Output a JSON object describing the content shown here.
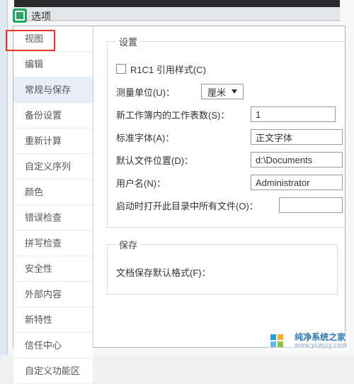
{
  "header": {
    "title": "选项"
  },
  "sidebar": {
    "items": [
      "视图",
      "编辑",
      "常规与保存",
      "备份设置",
      "重新计算",
      "自定义序列",
      "颜色",
      "错误检查",
      "拼写检查",
      "安全性",
      "外部内容",
      "新特性",
      "信任中心",
      "自定义功能区"
    ],
    "selected_index": 2,
    "highlighted_index": 0
  },
  "content": {
    "settings": {
      "legend": "设置",
      "r1c1_label": "R1C1 引用样式(C)",
      "r1c1_checked": false,
      "unit_label": "测量单位(U)：",
      "unit_value": "厘米",
      "sheets_label": "新工作簿内的工作表数(S)：",
      "sheets_value": "1",
      "font_label": "标准字体(A)：",
      "font_value": "正文字体",
      "path_label": "默认文件位置(D)：",
      "path_value": "d:\\Documents",
      "user_label": "用户名(N)：",
      "user_value": "Administrator",
      "openall_label": "启动时打开此目录中所有文件(O)：",
      "openall_value": ""
    },
    "save": {
      "legend": "保存",
      "format_label": "文档保存默认格式(F)："
    }
  },
  "watermark": {
    "line1": "纯净系统之家",
    "line2": "www.ycwjzy.com"
  }
}
